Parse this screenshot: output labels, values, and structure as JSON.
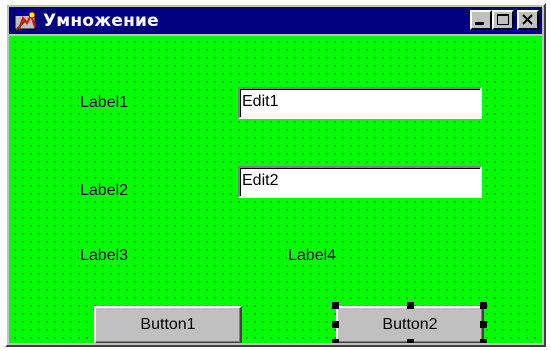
{
  "window": {
    "title": "Умножение",
    "icon": "delphi-form-icon",
    "controls": [
      "minimize-icon",
      "maximize-icon",
      "close-icon"
    ]
  },
  "form": {
    "background_color": "#00ff00",
    "label1": "Label1",
    "label2": "Label2",
    "label3": "Label3",
    "label4": "Label4",
    "edit1": "Edit1",
    "edit2": "Edit2",
    "button1": "Button1",
    "button2": "Button2",
    "selected_component": "Button2"
  },
  "colors": {
    "titlebar": "#000080",
    "face": "#c0c0c0"
  }
}
